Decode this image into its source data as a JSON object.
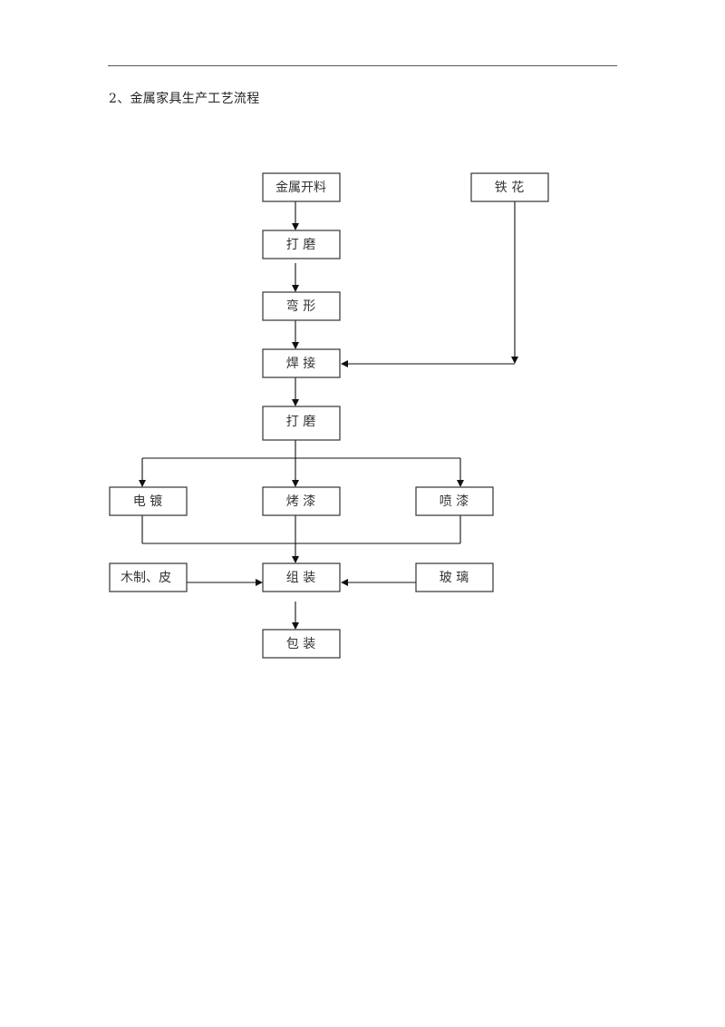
{
  "document": {
    "heading": "2、金属家具生产工艺流程"
  },
  "flowchart": {
    "nodes": {
      "cutting": "金属开料",
      "iron_flower": "铁 花",
      "polish1": "打 磨",
      "bending": "弯 形",
      "welding": "焊 接",
      "polish2": "打 磨",
      "electroplate": "电 镀",
      "bake_paint": "烤 漆",
      "spray_paint": "喷 漆",
      "wood_leather": "木制、皮",
      "assembly": "组 装",
      "glass": "玻 璃",
      "packaging": "包 装"
    },
    "edges": [
      [
        "cutting",
        "polish1"
      ],
      [
        "polish1",
        "bending"
      ],
      [
        "bending",
        "welding"
      ],
      [
        "iron_flower",
        "welding"
      ],
      [
        "welding",
        "polish2"
      ],
      [
        "polish2",
        "electroplate"
      ],
      [
        "polish2",
        "bake_paint"
      ],
      [
        "polish2",
        "spray_paint"
      ],
      [
        "electroplate",
        "assembly"
      ],
      [
        "bake_paint",
        "assembly"
      ],
      [
        "spray_paint",
        "assembly"
      ],
      [
        "wood_leather",
        "assembly"
      ],
      [
        "glass",
        "assembly"
      ],
      [
        "assembly",
        "packaging"
      ]
    ]
  }
}
